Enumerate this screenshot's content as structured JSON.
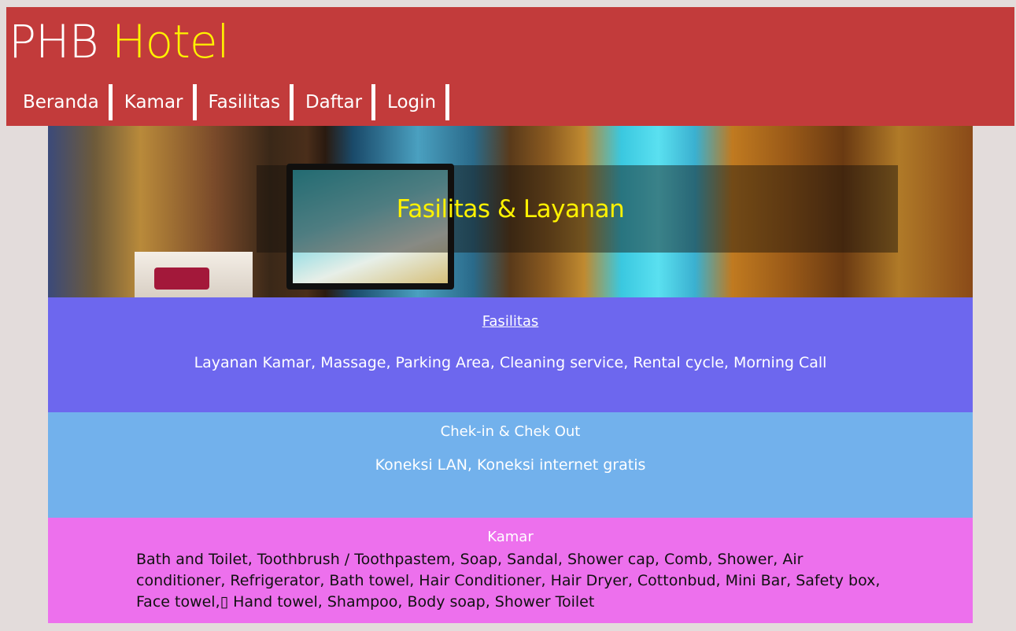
{
  "header": {
    "brand_prefix": "PHB",
    "brand_accent": "Hotel",
    "brand_color": "#ffffff",
    "accent_color": "#fff200",
    "background": "#c23b3b"
  },
  "nav": {
    "items": [
      {
        "label": "Beranda"
      },
      {
        "label": "Kamar"
      },
      {
        "label": "Fasilitas"
      },
      {
        "label": "Daftar"
      },
      {
        "label": "Login"
      }
    ]
  },
  "hero": {
    "caption": "Fasilitas & Layanan"
  },
  "sections": {
    "fasilitas": {
      "title": "Fasilitas",
      "body": "Layanan Kamar, Massage, Parking Area, Cleaning service, Rental cycle, Morning Call",
      "background": "#6d67ee"
    },
    "checkin": {
      "title": "Chek-in & Chek Out",
      "body": "Koneksi LAN, Koneksi internet gratis",
      "background": "#72b1ec"
    },
    "kamar": {
      "title": "Kamar",
      "body": "Bath and Toilet, Toothbrush / Toothpastem, Soap, Sandal, Shower cap, Comb, Shower, Air conditioner, Refrigerator, Bath towel, Hair Conditioner, Hair Dryer, Cottonbud, Mini Bar, Safety box, Face towel,▯ Hand towel, Shampoo, Body soap, Shower Toilet",
      "background": "#ed70ed"
    }
  }
}
